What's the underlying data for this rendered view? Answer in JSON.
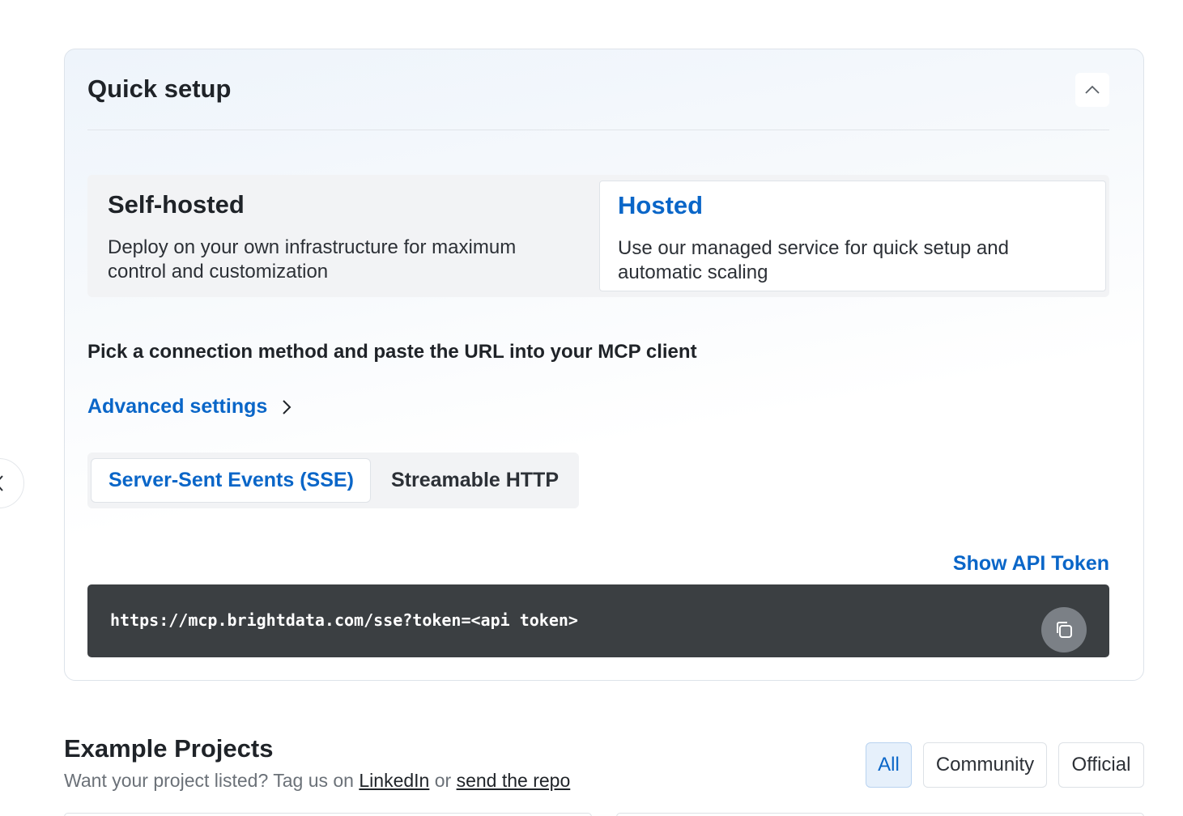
{
  "quick_setup": {
    "title": "Quick setup",
    "collapse_icon": "chevron-up-icon",
    "hosting": {
      "self_hosted": {
        "title": "Self-hosted",
        "description": "Deploy on your own infrastructure for maximum control and customization"
      },
      "hosted": {
        "title": "Hosted",
        "description": "Use our managed service for quick setup and automatic scaling",
        "selected": true
      }
    },
    "instruction": "Pick a connection method and paste the URL into your MCP client",
    "advanced_settings": "Advanced settings",
    "methods": {
      "sse": {
        "label": "Server-Sent Events (SSE)",
        "selected": true
      },
      "http": {
        "label": "Streamable HTTP"
      }
    },
    "show_token": "Show API Token",
    "url": "https://mcp.brightdata.com/sse?token=<api token>",
    "copy_icon": "copy-icon"
  },
  "examples": {
    "title": "Example Projects",
    "subtitle_prefix": "Want your project listed? Tag us on ",
    "link_linkedin": "LinkedIn",
    "subtitle_or": " or ",
    "link_repo": "send the repo",
    "filters": {
      "all": "All",
      "community": "Community",
      "official": "Official"
    },
    "active_filter": "All"
  },
  "colors": {
    "accent": "#0a66c8",
    "code_bg": "#3b3f42"
  }
}
